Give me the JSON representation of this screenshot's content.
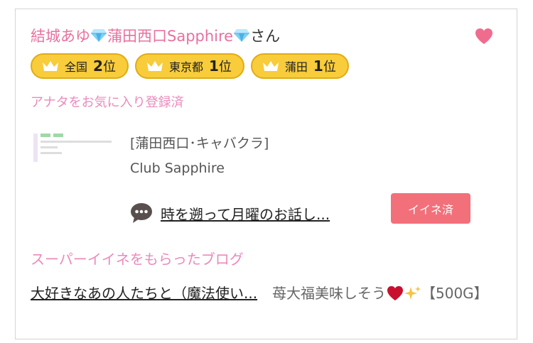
{
  "card": {
    "name_pink": "結城あゆ",
    "gem1_icon": "diamond-icon",
    "name_shop": "蒲田西口Sapphire",
    "gem2_icon": "diamond-icon",
    "name_suffix": "さん",
    "heart_icon": "heart-icon",
    "badges": [
      {
        "area": "全国",
        "rank": "2",
        "unit": "位"
      },
      {
        "area": "東京都",
        "rank": "1",
        "unit": "位"
      },
      {
        "area": "蒲田",
        "rank": "1",
        "unit": "位"
      }
    ],
    "favorite_status": "アナタをお気に入り登録済",
    "shop": {
      "category": "[蒲田西口･キャバクラ]",
      "name": "Club Sapphire"
    },
    "blog": {
      "title": "時を遡って月曜のお話し...",
      "iine_label": "イイネ済"
    },
    "super_iine": {
      "heading": "スーパーイイネをもらったブログ",
      "link_text": "大好きなあの人たちと（魔法使い...",
      "comment_before": "苺大福美味しそう",
      "comment_after": "【500G】"
    }
  },
  "colors": {
    "pink_text": "#e8719e",
    "heart": "#f06c8f",
    "badge_fill": "#f8cc3a",
    "iine_button": "#f2707a"
  }
}
